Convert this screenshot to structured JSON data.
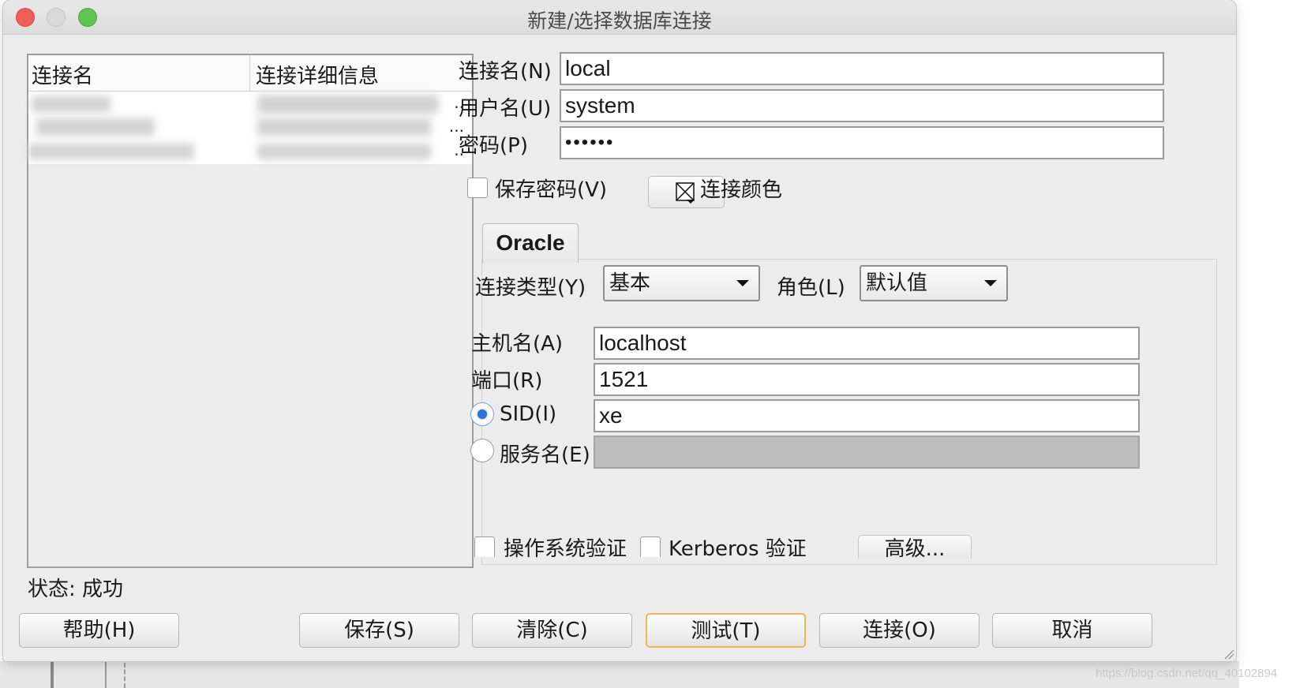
{
  "window": {
    "title": "新建/选择数据库连接"
  },
  "conn_list": {
    "columns": [
      "连接名",
      "连接详细信息"
    ],
    "row_ellipses": [
      "..",
      "...",
      ".."
    ]
  },
  "status": "状态: 成功",
  "form": {
    "conn_name_label": "连接名(N)",
    "conn_name_value": "local",
    "user_label": "用户名(U)",
    "user_value": "system",
    "password_label": "密码(P)",
    "password_value": "••••••",
    "save_password_label": "保存密码(V)",
    "save_password_checked": false,
    "conn_color_label": "连接颜色"
  },
  "tab": {
    "label": "Oracle"
  },
  "oracle": {
    "conn_type_label": "连接类型(Y)",
    "conn_type_value": "基本",
    "role_label": "角色(L)",
    "role_value": "默认值",
    "host_label": "主机名(A)",
    "host_value": "localhost",
    "port_label": "端口(R)",
    "port_value": "1521",
    "sid_label": "SID(I)",
    "sid_value": "xe",
    "sid_selected": true,
    "service_label": "服务名(E)",
    "service_value": "",
    "os_auth_label": "操作系统验证",
    "kerberos_label": "Kerberos 验证",
    "advanced_label": "高级..."
  },
  "buttons": {
    "help": "帮助(H)",
    "save": "保存(S)",
    "clear": "清除(C)",
    "test": "测试(T)",
    "connect": "连接(O)",
    "cancel": "取消"
  },
  "watermark": "https://blog.csdn.net/qq_40102894",
  "colors": {
    "window_bg": "#ececec",
    "close": "#ee5e57",
    "maximize": "#5fc453",
    "focus_ring": "#f0b35a",
    "radio_selected": "#2f6fd6"
  }
}
